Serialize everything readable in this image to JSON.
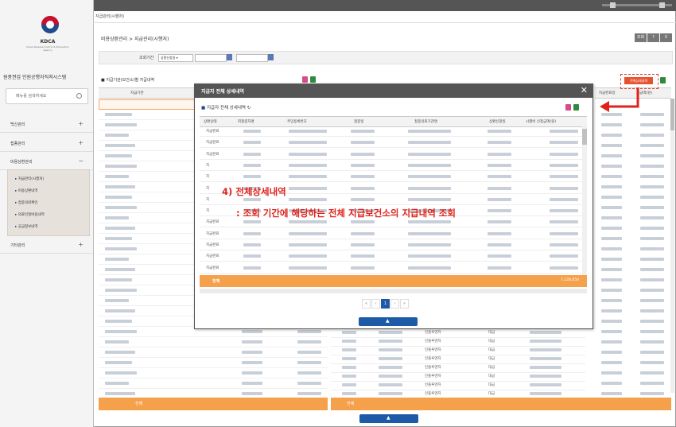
{
  "logo": {
    "name": "KDCA",
    "subtitle": "Korea Disease Control & Prevention Agency"
  },
  "sidebar": {
    "system_name": "원풍권검 인원공행자직쳐시스템",
    "search_placeholder": "메뉴를 검색하세요",
    "menus": [
      {
        "label": "백신관리",
        "toggle": "+"
      },
      {
        "label": "접종관리",
        "toggle": "+"
      },
      {
        "label": "비용상환관리",
        "toggle": "−"
      },
      {
        "label": "기타관리",
        "toggle": "+"
      }
    ],
    "submenu": [
      "지급관리(시행처)",
      "비용상환내역",
      "접종의뢰확인",
      "의료인정비용내역",
      "공급정보내역"
    ]
  },
  "header": {
    "tab_label": "지급관리(시행처)",
    "page_title": "비용상환관리 > 지급관리(시행처)",
    "buttons": [
      "조회",
      "?",
      "X"
    ]
  },
  "filter": {
    "label": "조회기간",
    "select_value": "상환신청일 ▾"
  },
  "left_panel": {
    "title": "지급기관(보건소)별 지급내역",
    "column_header": "지급기관",
    "total_label": "전체"
  },
  "right_panel": {
    "columns": [
      "지급완료일",
      "지급액(원)"
    ],
    "rows": [
      {
        "type": "인플루엔자",
        "status": "대금"
      },
      {
        "type": "인플루엔자",
        "status": "대금"
      },
      {
        "type": "인플루엔자",
        "status": "대금"
      },
      {
        "type": "인플루엔자",
        "status": "대금"
      },
      {
        "type": "인플루엔자",
        "status": "대금"
      },
      {
        "type": "인플루엔자",
        "status": "대금"
      },
      {
        "type": "인플루엔자",
        "status": "대금"
      },
      {
        "type": "인플루엔자",
        "status": "대금"
      }
    ],
    "total_label": "전체"
  },
  "detail_button_label": "전체상세내역",
  "modal": {
    "title": "지급자 전체 상세내역",
    "subtitle": "지급자 전체 상세내역",
    "columns": [
      "상환상태",
      "피접종자명",
      "주민등록번호",
      "접종일",
      "접종의료기관명",
      "상환신청일",
      "시행비 신청금액(원)"
    ],
    "row_statuses": [
      "지급완료",
      "지급완료",
      "지급완료",
      "지",
      "지",
      "지",
      "지",
      "지",
      "지급완료",
      "지급완료",
      "지급완료",
      "지급완료",
      "지급완료"
    ],
    "total_label": "전체",
    "total_value": "7,228,050",
    "pager": [
      "«",
      "‹",
      "1",
      "›",
      "»"
    ],
    "current_page": "1"
  },
  "callout": {
    "title": "4) 전체상세내역",
    "description": ": 조회 기간에 해당하는 전체 지급보건소의 지급내역 조회"
  },
  "colors": {
    "orange": "#f5a04a",
    "blue": "#1d5aa8",
    "red": "#e0221b",
    "header_dark": "#555555"
  }
}
